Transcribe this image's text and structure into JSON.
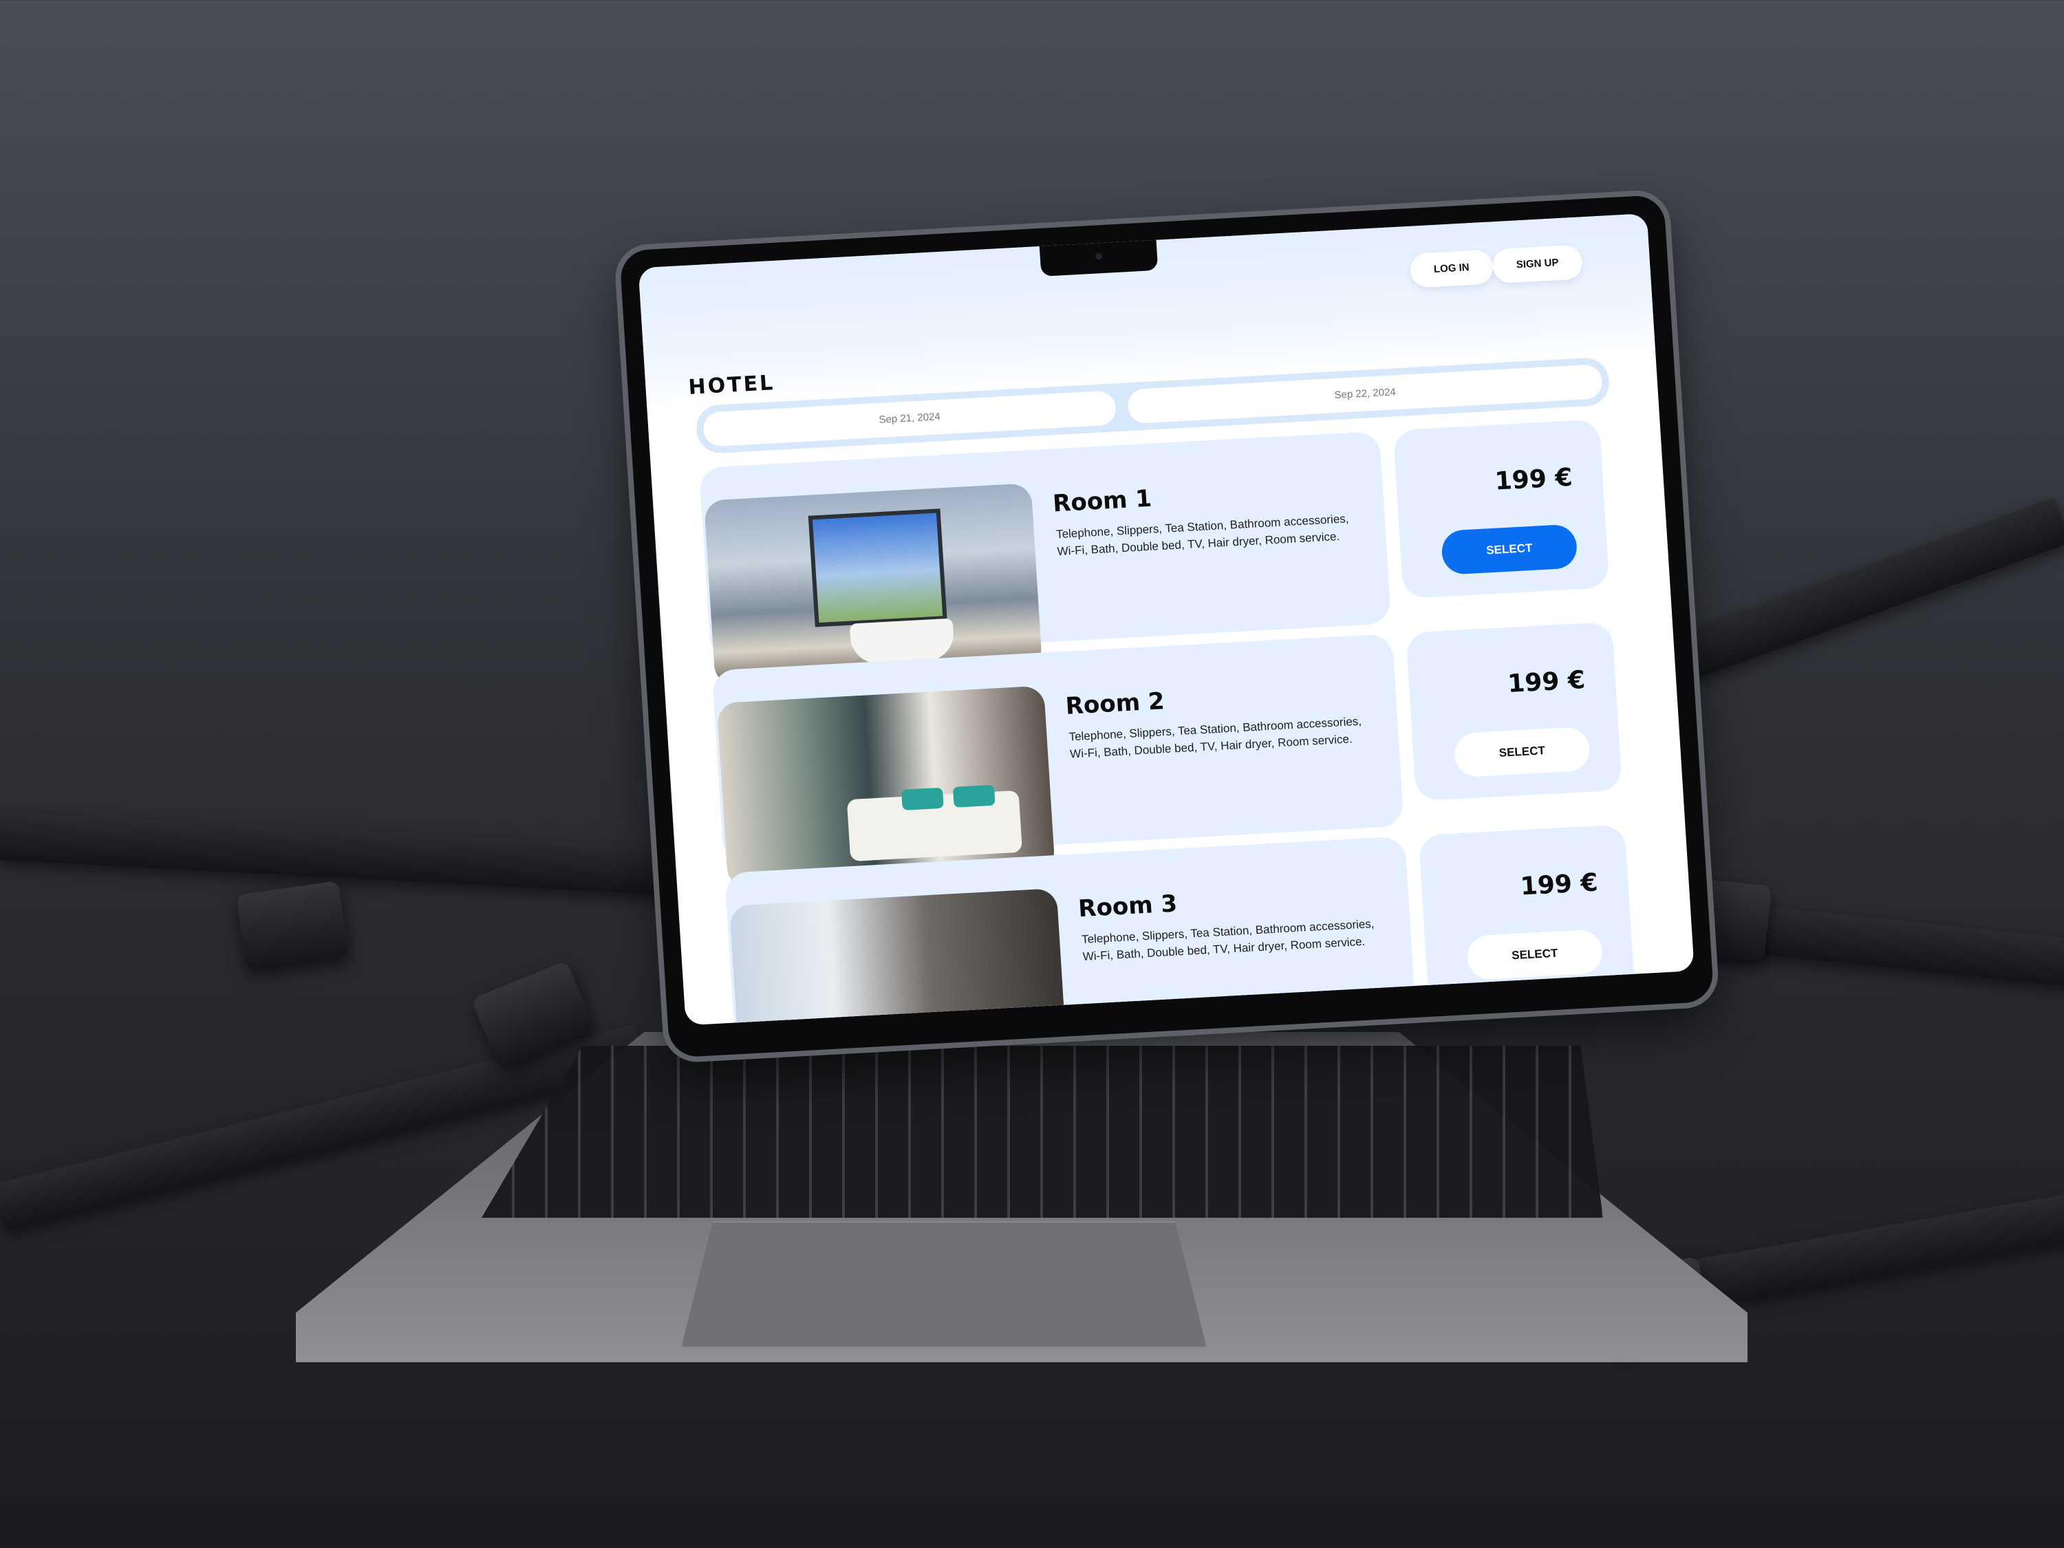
{
  "site": {
    "logo": "HOTEL",
    "login_label": "LOG IN",
    "signup_label": "SIGN UP"
  },
  "dates": {
    "check_in": "Sep 21, 2024",
    "check_out": "Sep 22, 2024"
  },
  "rooms": [
    {
      "name": "Room 1",
      "amenities": "Telephone, Slippers, Tea Station, Bathroom accessories, Wi-Fi, Bath, Double bed, TV, Hair dryer, Room service.",
      "price": "199 €",
      "select_label": "SELECT",
      "selected": true
    },
    {
      "name": "Room 2",
      "amenities": "Telephone, Slippers, Tea Station, Bathroom accessories, Wi-Fi, Bath, Double bed, TV, Hair dryer, Room service.",
      "price": "199 €",
      "select_label": "SELECT",
      "selected": false
    },
    {
      "name": "Room 3",
      "amenities": "Telephone, Slippers, Tea Station, Bathroom accessories, Wi-Fi, Bath, Double bed, TV, Hair dryer, Room service.",
      "price": "199 €",
      "select_label": "SELECT",
      "selected": false
    }
  ],
  "colors": {
    "accent": "#0a6ef0",
    "card_bg": "#e4efff",
    "header_bg": "#e3efff"
  }
}
